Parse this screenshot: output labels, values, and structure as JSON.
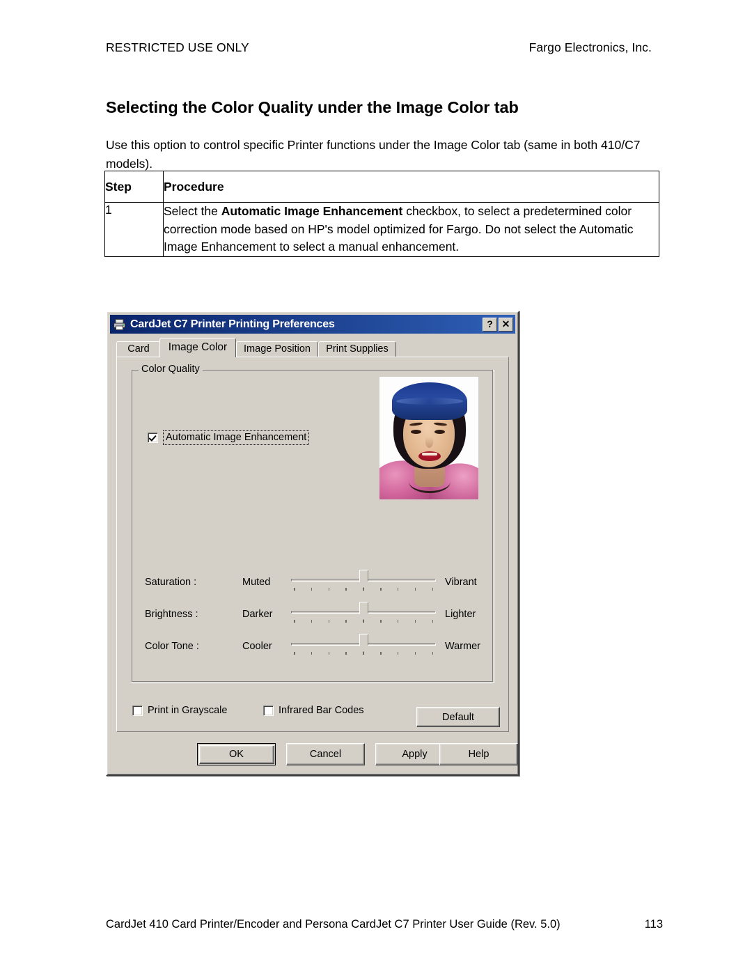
{
  "page": {
    "header_left": "RESTRICTED USE ONLY",
    "header_right": "Fargo Electronics, Inc.",
    "title": "Selecting the Color Quality under the Image Color tab",
    "intro": "Use this option to control specific Printer functions under the Image Color tab (same in both 410/C7 models).",
    "footer_left": "CardJet 410 Card Printer/Encoder and Persona CardJet C7 Printer User Guide (Rev. 5.0)",
    "footer_page": "113"
  },
  "table": {
    "headers": [
      "Step",
      "Procedure"
    ],
    "rows": [
      {
        "step": "1",
        "procedure_lead": "Select the ",
        "procedure_bold": "Automatic Image Enhancement",
        "procedure_tail": " checkbox, to select a predetermined color correction mode based on HP's model optimized for Fargo. Do not select the Automatic Image Enhancement to select a manual enhancement."
      }
    ]
  },
  "dialog": {
    "title": "CardJet C7 Printer Printing Preferences",
    "titlebar_color": "#0a246a",
    "face_color": "#d4d0c8",
    "icon": "printer-icon",
    "help_button": "?",
    "close_button": "✕",
    "tabs": [
      {
        "label": "Card",
        "active": false
      },
      {
        "label": "Image Color",
        "active": true
      },
      {
        "label": "Image Position",
        "active": false
      },
      {
        "label": "Print Supplies",
        "active": false
      }
    ],
    "group": {
      "label": "Color Quality",
      "auto_enhancement": {
        "label": "Automatic Image Enhancement",
        "accel": "I",
        "checked": true,
        "focused": true
      },
      "preview_photo": "portrait-preview-photo",
      "sliders": [
        {
          "name": "Saturation :",
          "accel": "S",
          "min_label": "Muted",
          "max_label": "Vibrant",
          "ticks": 9,
          "value": 5
        },
        {
          "name": "Brightness :",
          "accel": "h",
          "min_label": "Darker",
          "max_label": "Lighter",
          "ticks": 9,
          "value": 5
        },
        {
          "name": "Color Tone :",
          "accel": "C",
          "min_label": "Cooler",
          "max_label": "Warmer",
          "ticks": 9,
          "value": 5
        }
      ]
    },
    "options": [
      {
        "label": "Print in Grayscale",
        "accel": "G",
        "checked": false
      },
      {
        "label": "Infrared Bar Codes",
        "accel": "",
        "checked": false
      }
    ],
    "default_button": {
      "label": "Default",
      "accel": "f"
    },
    "buttons": [
      {
        "label": "OK",
        "is_default": true
      },
      {
        "label": "Cancel",
        "is_default": false
      },
      {
        "label": "Apply",
        "accel": "A",
        "is_default": false
      },
      {
        "label": "Help",
        "is_default": false
      }
    ]
  }
}
